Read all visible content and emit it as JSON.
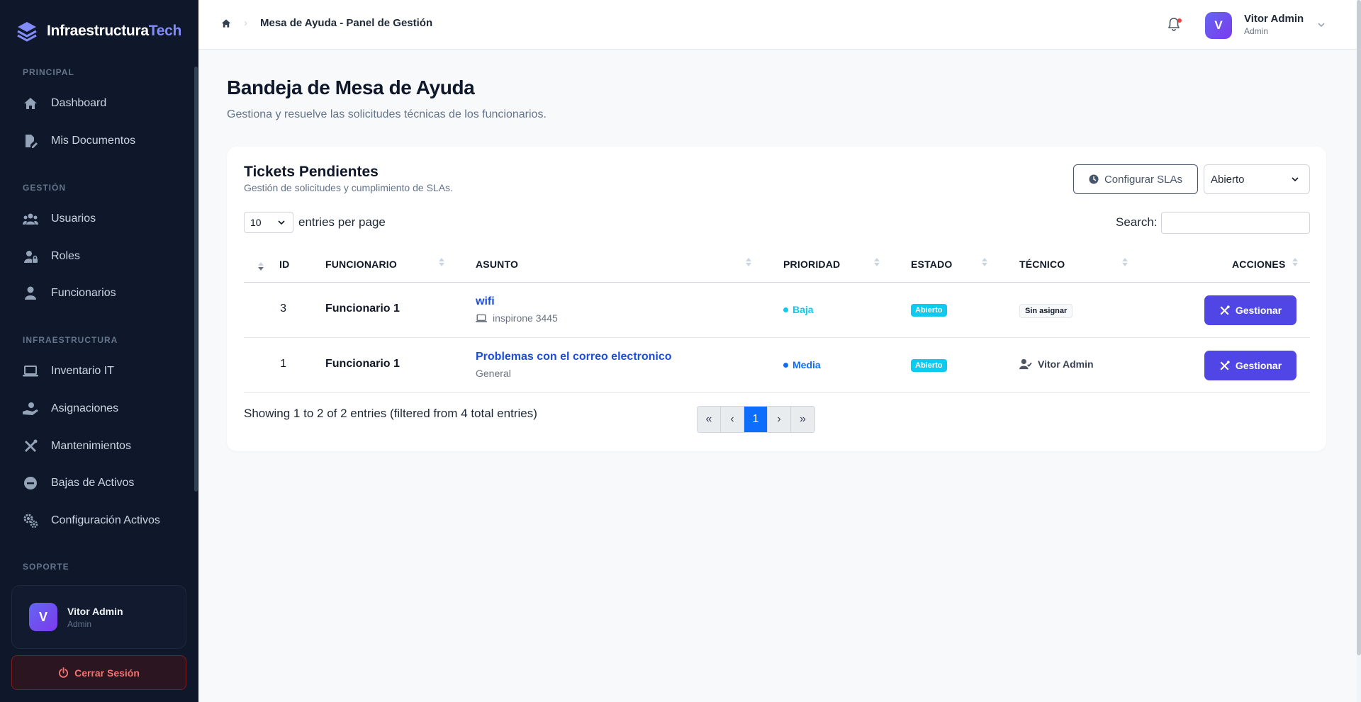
{
  "brand": {
    "name": "Infraestructura",
    "accent": "Tech"
  },
  "sidebar": {
    "sections": {
      "principal": "PRINCIPAL",
      "gestion": "GESTIÓN",
      "infraestructura": "INFRAESTRUCTURA",
      "soporte": "SOPORTE"
    },
    "items": [
      {
        "label": "Dashboard",
        "icon": "home-icon"
      },
      {
        "label": "Mis Documentos",
        "icon": "document-edit-icon"
      },
      {
        "label": "Usuarios",
        "icon": "users-icon"
      },
      {
        "label": "Roles",
        "icon": "user-lock-icon"
      },
      {
        "label": "Funcionarios",
        "icon": "user-icon"
      },
      {
        "label": "Inventario IT",
        "icon": "laptop-icon"
      },
      {
        "label": "Asignaciones",
        "icon": "hand-user-icon"
      },
      {
        "label": "Mantenimientos",
        "icon": "tools-icon"
      },
      {
        "label": "Bajas de Activos",
        "icon": "minus-circle-icon"
      },
      {
        "label": "Configuración Activos",
        "icon": "gears-icon"
      }
    ],
    "user": {
      "initial": "V",
      "name": "Vitor Admin",
      "role": "Admin"
    },
    "logout_label": "Cerrar Sesión"
  },
  "header": {
    "breadcrumb_current": "Mesa de Ayuda - Panel de Gestión",
    "user": {
      "initial": "V",
      "name": "Vitor Admin",
      "role": "Admin"
    }
  },
  "page": {
    "title": "Bandeja de Mesa de Ayuda",
    "subtitle": "Gestiona y resuelve las solicitudes técnicas de los funcionarios."
  },
  "card": {
    "title": "Tickets Pendientes",
    "subtitle": "Gestión de solicitudes y cumplimiento de SLAs.",
    "sla_button": "Configurar SLAs",
    "status_filter": "Abierto",
    "page_length": "10",
    "page_length_label": "entries per page",
    "search_label": "Search:",
    "search_value": ""
  },
  "table": {
    "columns": [
      "ID",
      "FUNCIONARIO",
      "ASUNTO",
      "PRIORIDAD",
      "ESTADO",
      "TÉCNICO",
      "ACCIONES"
    ],
    "rows": [
      {
        "id": "3",
        "funcionario": "Funcionario 1",
        "asunto": "wifi",
        "asunto_sub": "inspirone 3445",
        "prioridad": "Baja",
        "prioridad_color": "#0dcaf0",
        "estado": "Abierto",
        "tecnico": "Sin asignar",
        "action": "Gestionar"
      },
      {
        "id": "1",
        "funcionario": "Funcionario 1",
        "asunto": "Problemas con el correo electronico",
        "asunto_sub": "General",
        "prioridad": "Media",
        "prioridad_color": "#0d6efd",
        "estado": "Abierto",
        "tecnico": "Vitor Admin",
        "action": "Gestionar"
      }
    ]
  },
  "footer": {
    "info": "Showing 1 to 2 of 2 entries (filtered from 4 total entries)",
    "pager": [
      "«",
      "‹",
      "1",
      "›",
      "»"
    ]
  },
  "colors": {
    "accent": "#4f46e5",
    "sidebar_bg": "#0f172a",
    "link": "#1d4ed8"
  }
}
